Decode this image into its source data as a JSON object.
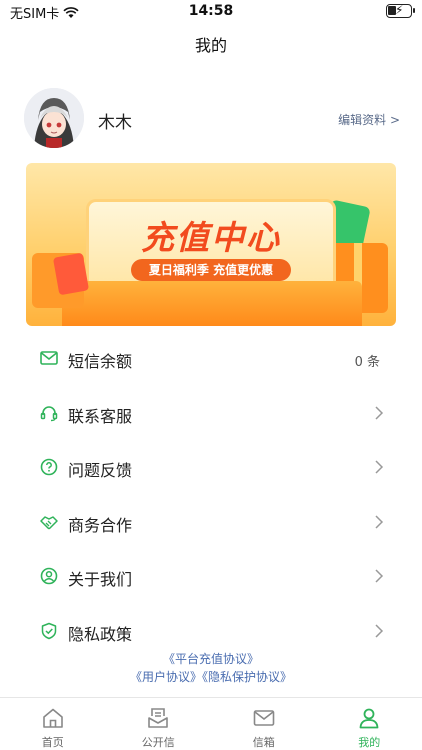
{
  "status_bar": {
    "carrier": "无SIM卡",
    "time": "14:58"
  },
  "nav": {
    "title": "我的"
  },
  "profile": {
    "name": "木木",
    "edit_label": "编辑资料 >"
  },
  "banner": {
    "title": "充值中心",
    "subtitle": "夏日福利季 充值更优惠"
  },
  "menu": {
    "items": [
      {
        "label": "短信余额",
        "value": "0 条",
        "icon": "mail-icon"
      },
      {
        "label": "联系客服",
        "icon": "headset-icon"
      },
      {
        "label": "问题反馈",
        "icon": "question-icon"
      },
      {
        "label": "商务合作",
        "icon": "handshake-icon"
      },
      {
        "label": "关于我们",
        "icon": "user-circle-icon"
      },
      {
        "label": "隐私政策",
        "icon": "shield-icon"
      }
    ]
  },
  "agreements": {
    "recharge": "《平台充值协议》",
    "user": "《用户协议》",
    "privacy": "《隐私保护协议》"
  },
  "tabbar": {
    "tabs": [
      {
        "label": "首页",
        "icon": "home-icon"
      },
      {
        "label": "公开信",
        "icon": "inbox-icon"
      },
      {
        "label": "信箱",
        "icon": "envelope-icon"
      },
      {
        "label": "我的",
        "icon": "person-icon",
        "active": true
      }
    ]
  },
  "colors": {
    "accent": "#2fb35a",
    "link": "#4a6db0",
    "banner_title": "#f24b1e"
  }
}
